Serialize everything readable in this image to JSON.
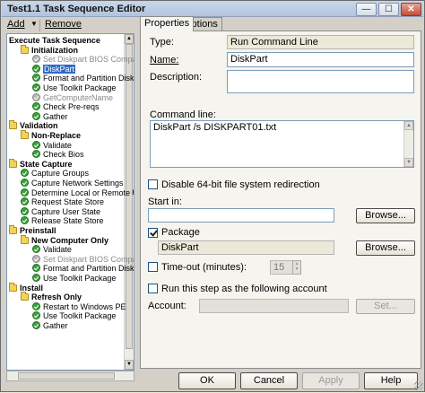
{
  "window": {
    "title": "Test1.1 Task Sequence Editor",
    "controls": {
      "minimize": "—",
      "maximize": "☐",
      "close": "✕"
    }
  },
  "toolbar": {
    "add_label": "Add",
    "remove_label": "Remove"
  },
  "tree": {
    "items": [
      {
        "label": "Execute Task Sequence",
        "kind": "group",
        "level": 0,
        "icon": "none"
      },
      {
        "label": "Initialization",
        "kind": "group",
        "level": 1,
        "icon": "folder-icon"
      },
      {
        "label": "Set Diskpart BIOS Compatibi",
        "kind": "step",
        "level": 2,
        "icon": "check-icon",
        "disabled": true
      },
      {
        "label": "DiskPart",
        "kind": "step",
        "level": 2,
        "icon": "check-icon",
        "selected": true
      },
      {
        "label": "Format and Partition Disk",
        "kind": "step",
        "level": 2,
        "icon": "check-icon"
      },
      {
        "label": "Use Toolkit Package",
        "kind": "step",
        "level": 2,
        "icon": "check-icon"
      },
      {
        "label": "GetComputerName",
        "kind": "step",
        "level": 2,
        "icon": "check-icon",
        "disabled": true
      },
      {
        "label": "Check Pre-reqs",
        "kind": "step",
        "level": 2,
        "icon": "check-icon"
      },
      {
        "label": "Gather",
        "kind": "step",
        "level": 2,
        "icon": "check-icon"
      },
      {
        "label": "Validation",
        "kind": "group",
        "level": 0,
        "icon": "folder-icon"
      },
      {
        "label": "Non-Replace",
        "kind": "group",
        "level": 1,
        "icon": "folder-icon"
      },
      {
        "label": "Validate",
        "kind": "step",
        "level": 2,
        "icon": "check-icon"
      },
      {
        "label": "Check Bios",
        "kind": "step",
        "level": 2,
        "icon": "check-icon"
      },
      {
        "label": "State Capture",
        "kind": "group",
        "level": 0,
        "icon": "folder-icon"
      },
      {
        "label": "Capture Groups",
        "kind": "step",
        "level": 1,
        "icon": "check-icon"
      },
      {
        "label": "Capture Network Settings",
        "kind": "step",
        "level": 1,
        "icon": "check-icon"
      },
      {
        "label": "Determine Local or Remote U",
        "kind": "step",
        "level": 1,
        "icon": "check-icon"
      },
      {
        "label": "Request State Store",
        "kind": "step",
        "level": 1,
        "icon": "check-icon"
      },
      {
        "label": "Capture User State",
        "kind": "step",
        "level": 1,
        "icon": "check-icon"
      },
      {
        "label": "Release State Store",
        "kind": "step",
        "level": 1,
        "icon": "check-icon"
      },
      {
        "label": "Preinstall",
        "kind": "group",
        "level": 0,
        "icon": "folder-icon"
      },
      {
        "label": "New Computer Only",
        "kind": "group",
        "level": 1,
        "icon": "folder-icon"
      },
      {
        "label": "Validate",
        "kind": "step",
        "level": 2,
        "icon": "check-icon"
      },
      {
        "label": "Set Diskpart BIOS Compa",
        "kind": "step",
        "level": 2,
        "icon": "check-icon",
        "disabled": true
      },
      {
        "label": "Format and Partition Disk",
        "kind": "step",
        "level": 2,
        "icon": "check-icon"
      },
      {
        "label": "Use Toolkit Package",
        "kind": "step",
        "level": 2,
        "icon": "check-icon"
      },
      {
        "label": "Install",
        "kind": "group",
        "level": 0,
        "icon": "folder-icon"
      },
      {
        "label": "Refresh Only",
        "kind": "group",
        "level": 1,
        "icon": "folder-icon"
      },
      {
        "label": "Restart to Windows PE",
        "kind": "step",
        "level": 2,
        "icon": "check-icon"
      },
      {
        "label": "Use Toolkit Package",
        "kind": "step",
        "level": 2,
        "icon": "check-icon"
      },
      {
        "label": "Gather",
        "kind": "step",
        "level": 2,
        "icon": "check-icon"
      }
    ]
  },
  "tabs": [
    {
      "label": "Properties",
      "active": true
    },
    {
      "label": "Options",
      "active": false
    }
  ],
  "properties": {
    "type_label": "Type:",
    "type_value": "Run Command Line",
    "name_label": "Name:",
    "name_value": "DiskPart",
    "description_label": "Description:",
    "description_value": "",
    "command_line_label": "Command line:",
    "command_line_value": "DiskPart /s DISKPART01.txt",
    "disable_fs_redirection_label": "Disable 64-bit file system redirection",
    "disable_fs_redirection_checked": false,
    "start_in_label": "Start in:",
    "start_in_value": "",
    "browse_label": "Browse...",
    "package_label": "Package",
    "package_checked": true,
    "package_value": "DiskPart",
    "browse2_label": "Browse...",
    "timeout_label": "Time-out (minutes):",
    "timeout_checked": false,
    "timeout_value": "15",
    "run_as_label": "Run this step as the following account",
    "run_as_checked": false,
    "account_label": "Account:",
    "account_value": "",
    "set_label": "Set..."
  },
  "footer": {
    "ok_label": "OK",
    "cancel_label": "Cancel",
    "apply_label": "Apply",
    "help_label": "Help"
  }
}
